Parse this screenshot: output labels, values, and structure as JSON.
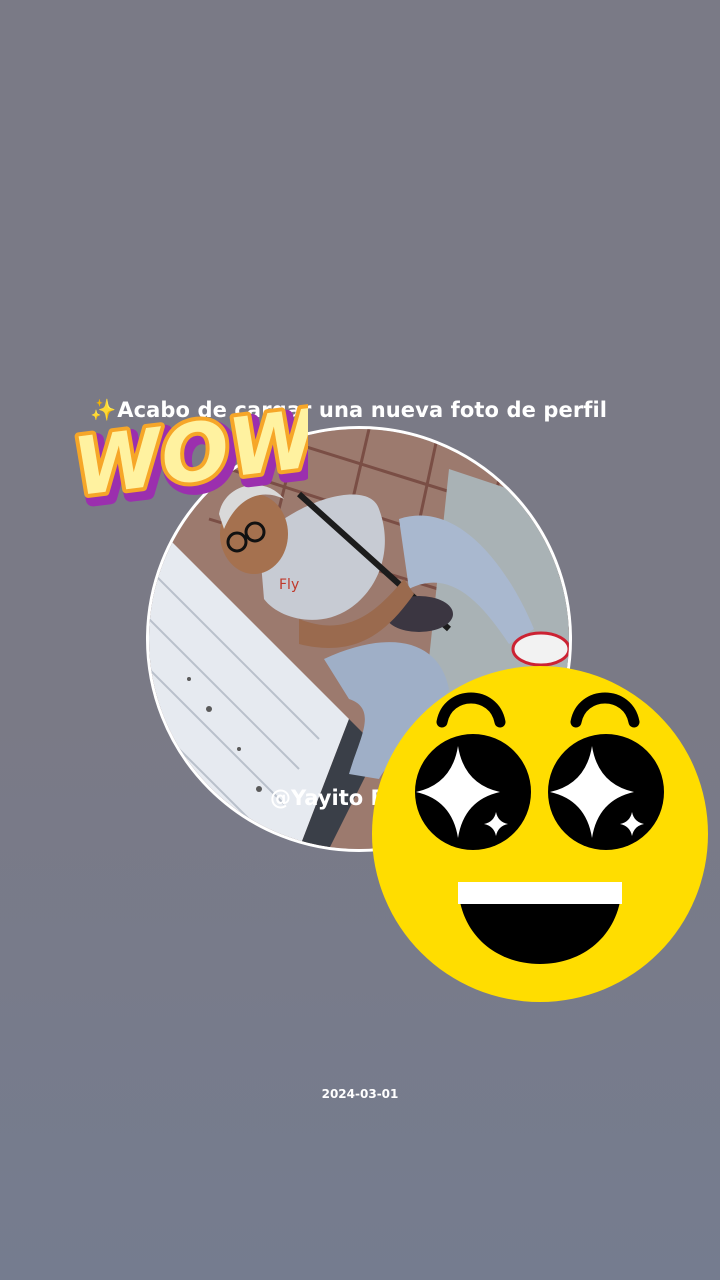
{
  "post": {
    "caption_icon": "✨",
    "caption": "Acabo de cargar una nueva foto de perfil",
    "username": "@Yayito Perez",
    "date": "2024-03-01"
  },
  "stickers": {
    "wow_text": "WOW!",
    "emoji": "star-struck-emoji-icon"
  },
  "colors": {
    "background": "#7a7a86",
    "emoji_yellow": "#ffdd00",
    "wow_fill": "#fff2a0",
    "wow_outline": "#9b2fae"
  }
}
